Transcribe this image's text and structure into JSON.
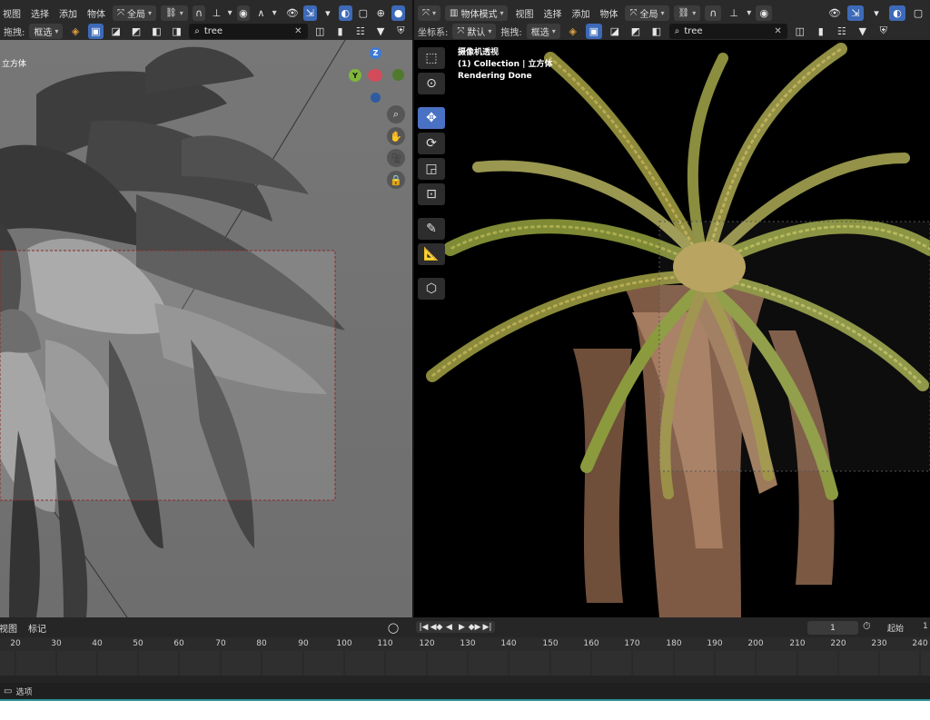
{
  "left_header": {
    "menu": [
      "视图",
      "选择",
      "添加",
      "物体"
    ],
    "orientation_label": "全局",
    "drag_label": "拖拽:",
    "select_mode": "框选",
    "search_value": "tree"
  },
  "right_header": {
    "editor_icon": "editor-type-icon",
    "mode_label": "物体模式",
    "menu": [
      "视图",
      "选择",
      "添加",
      "物体"
    ],
    "orientation_label": "全局",
    "coord_label": "坐标系:",
    "coord_value": "默认",
    "drag_label": "拖拽:",
    "select_mode": "框选",
    "search_value": "tree"
  },
  "left_viewport": {
    "object_text": "立方体"
  },
  "right_viewport": {
    "view_name": "摄像机透视",
    "collection_text": "(1) Collection | 立方体",
    "render_status": "Rendering Done"
  },
  "gizmo": {
    "z": "Z",
    "y": "Y",
    "x_color": "#d34b5a",
    "y_color": "#7fb63c",
    "z_color": "#3e7bd6"
  },
  "timeline": {
    "menu": [
      "视图",
      "标记"
    ],
    "current_frame": "1",
    "start_label": "起始",
    "start_value": "1",
    "ticks": [
      "20",
      "30",
      "40",
      "50",
      "60",
      "70",
      "80",
      "90",
      "100",
      "110",
      "120",
      "130",
      "140",
      "150",
      "160",
      "170",
      "180",
      "190",
      "200",
      "210",
      "220",
      "230",
      "240"
    ]
  },
  "statusbar": {
    "select_label": "选项"
  },
  "colors": {
    "accent": "#4a72c4",
    "status_line": "#2b8f96"
  }
}
